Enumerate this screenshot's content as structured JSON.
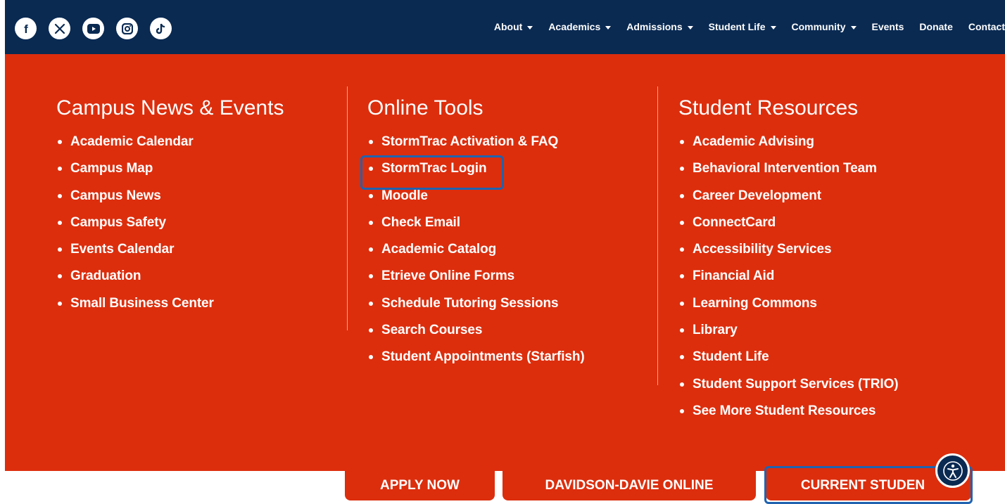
{
  "colors": {
    "navy": "#0a2a52",
    "menu_orange": "#dc2e0d",
    "highlight_blue": "#1f63b0",
    "text": "#ffffff"
  },
  "social": [
    {
      "icon": "facebook-icon"
    },
    {
      "icon": "x-twitter-icon"
    },
    {
      "icon": "youtube-icon"
    },
    {
      "icon": "instagram-icon"
    },
    {
      "icon": "tiktok-icon"
    }
  ],
  "nav": {
    "about": "About",
    "academics": "Academics",
    "admissions": "Admissions",
    "student_life": "Student Life",
    "community": "Community",
    "events": "Events",
    "donate": "Donate",
    "contact": "Contact"
  },
  "columns": {
    "campus": {
      "heading": "Campus News & Events",
      "items": [
        "Academic Calendar",
        "Campus Map",
        "Campus News",
        "Campus Safety",
        "Events Calendar",
        "Graduation",
        "Small Business Center"
      ]
    },
    "tools": {
      "heading": "Online Tools",
      "items": [
        "StormTrac Activation & FAQ",
        "StormTrac Login",
        "Moodle",
        "Check Email",
        "Academic Catalog",
        "Etrieve Online Forms",
        "Schedule Tutoring Sessions",
        "Search Courses",
        "Student Appointments (Starfish)"
      ]
    },
    "resources": {
      "heading": "Student Resources",
      "items": [
        "Academic Advising",
        "Behavioral Intervention Team",
        "Career Development",
        "ConnectCard",
        "Accessibility Services",
        "Financial Aid",
        "Learning Commons",
        "Library",
        "Student Life",
        "Student Support Services (TRIO)",
        "See More Student Resources"
      ]
    }
  },
  "tabs": {
    "apply": "APPLY NOW",
    "online": "DAVIDSON-DAVIE ONLINE",
    "current": "CURRENT STUDEN"
  },
  "accessibility": {
    "icon": "accessibility-icon"
  }
}
